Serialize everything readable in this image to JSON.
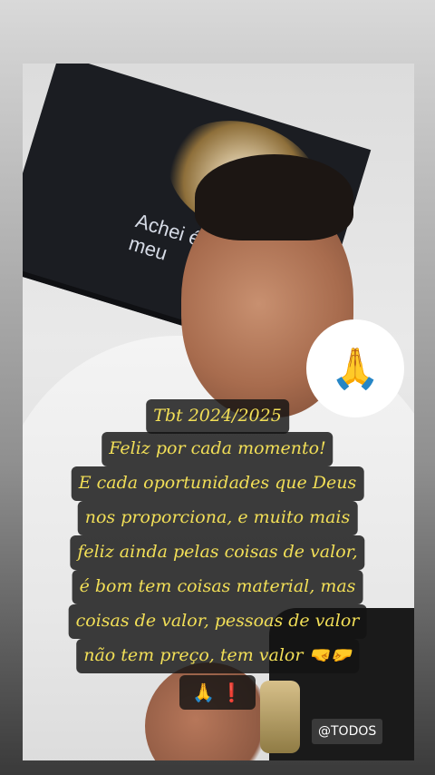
{
  "story": {
    "caption_lines": [
      "Tbt 2024/2025",
      "Feliz por cada momento!",
      "E cada oportunidades que Deus",
      "nos proporciona, e muito mais",
      "feliz ainda pelas coisas de valor,",
      "é bom tem coisas material, mas",
      "coisas de valor, pessoas de valor",
      "não tem preço, tem valor 🤜🤛"
    ],
    "emoji_line": [
      "🙏",
      "❗"
    ],
    "sticker_emoji": "🙏",
    "mention_tag": "@TODOS",
    "poster_text": [
      "Achei é",
      "meu"
    ],
    "colors": {
      "caption_text": "#f2df57",
      "caption_bg": "#141414"
    }
  }
}
